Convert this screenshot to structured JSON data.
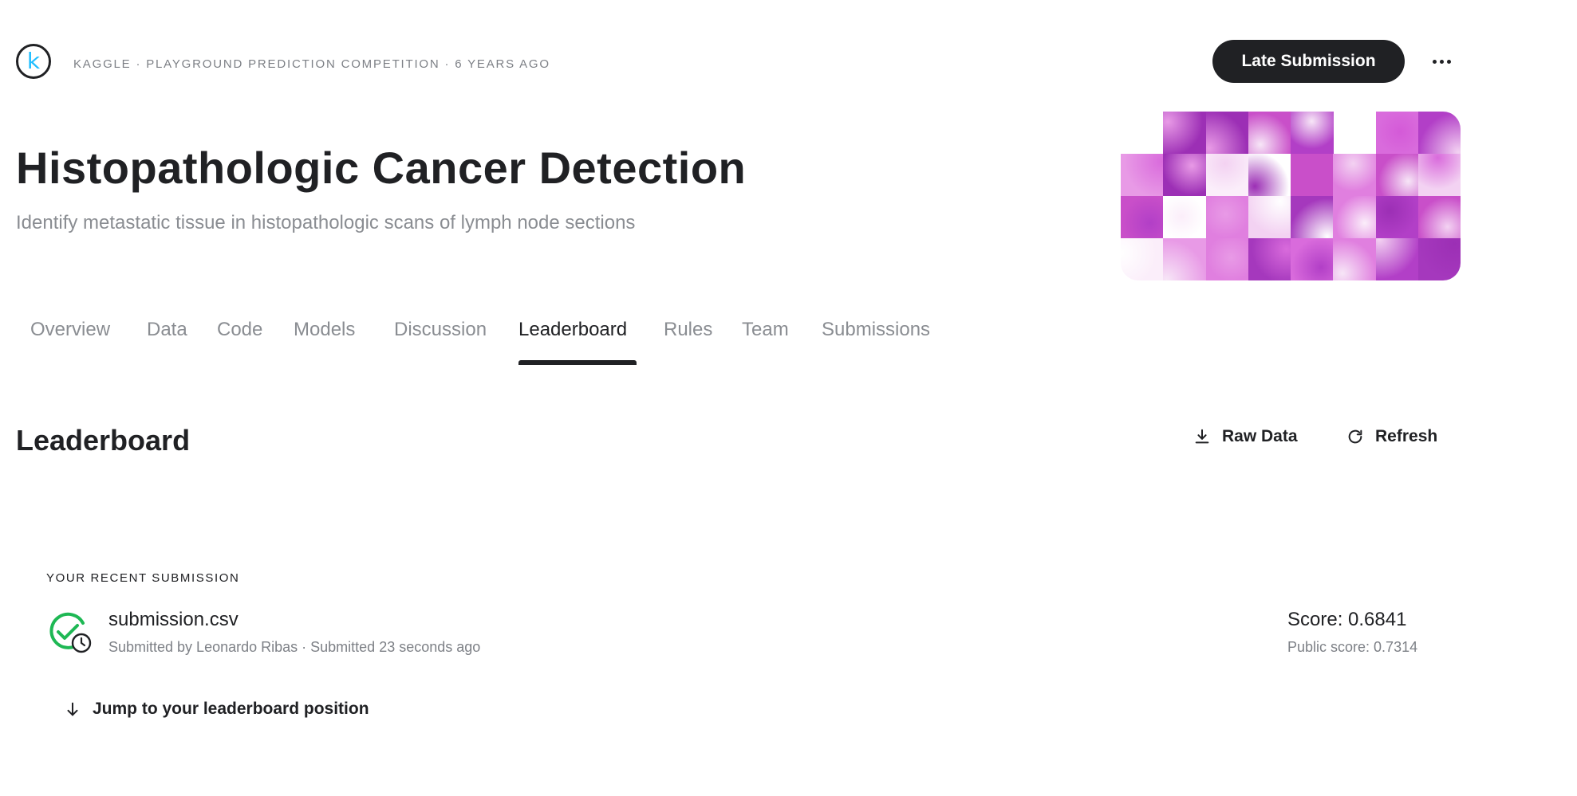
{
  "header": {
    "logo_letter": "k",
    "meta": "KAGGLE · PLAYGROUND PREDICTION COMPETITION · 6 YEARS AGO",
    "late_submission_label": "Late Submission"
  },
  "competition": {
    "title": "Histopathologic Cancer Detection",
    "subtitle": "Identify metastatic tissue in histopathologic scans of lymph node sections"
  },
  "tabs": [
    {
      "label": "Overview",
      "active": false
    },
    {
      "label": "Data",
      "active": false
    },
    {
      "label": "Code",
      "active": false
    },
    {
      "label": "Models",
      "active": false
    },
    {
      "label": "Discussion",
      "active": false
    },
    {
      "label": "Leaderboard",
      "active": true
    },
    {
      "label": "Rules",
      "active": false
    },
    {
      "label": "Team",
      "active": false
    },
    {
      "label": "Submissions",
      "active": false
    }
  ],
  "leaderboard": {
    "title": "Leaderboard",
    "raw_data_label": "Raw Data",
    "refresh_label": "Refresh"
  },
  "recent_submission": {
    "section_label": "YOUR RECENT SUBMISSION",
    "file_name": "submission.csv",
    "submitted_line": "Submitted by Leonardo Ribas · Submitted 23 seconds ago",
    "score": "Score: 0.6841",
    "public_score": "Public score: 0.7314",
    "status": "complete-pending"
  },
  "jump_label": "Jump to your leaderboard position",
  "colors": {
    "text_primary": "#202124",
    "text_secondary": "#7d8086",
    "success_green": "#1eb854",
    "logo_cyan": "#20beff",
    "button_dark": "#202124"
  },
  "icons": {
    "more": "more-horizontal-icon",
    "raw_data": "download-icon",
    "refresh": "refresh-icon",
    "status": "check-circle-clock-icon",
    "jump": "arrow-down-icon"
  }
}
